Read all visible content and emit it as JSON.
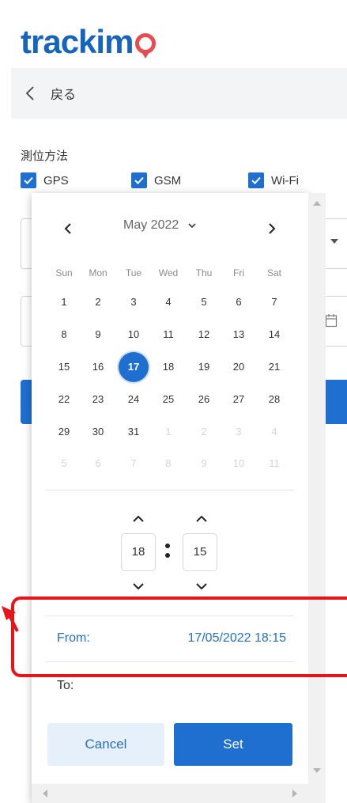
{
  "header": {
    "logo_text": "trackim",
    "brand_color": "#1565c0",
    "pin_color": "#e94b50"
  },
  "nav": {
    "back_label": "戻る"
  },
  "positioning": {
    "section_label": "測位方法",
    "options": [
      {
        "label": "GPS",
        "checked": true
      },
      {
        "label": "GSM",
        "checked": true
      },
      {
        "label": "Wi-Fi",
        "checked": true
      }
    ]
  },
  "picker": {
    "month_label": "May 2022",
    "weekdays": [
      "Sun",
      "Mon",
      "Tue",
      "Wed",
      "Thu",
      "Fri",
      "Sat"
    ],
    "weeks": [
      [
        "1",
        "2",
        "3",
        "4",
        "5",
        "6",
        "7"
      ],
      [
        "8",
        "9",
        "10",
        "11",
        "12",
        "13",
        "14"
      ],
      [
        "15",
        "16",
        "17",
        "18",
        "19",
        "20",
        "21"
      ],
      [
        "22",
        "23",
        "24",
        "25",
        "26",
        "27",
        "28"
      ],
      [
        "29",
        "30",
        "31",
        "1",
        "2",
        "3",
        "4"
      ],
      [
        "5",
        "6",
        "7",
        "8",
        "9",
        "10",
        "11"
      ]
    ],
    "selected_day": "17",
    "time": {
      "hour": "18",
      "minute": "15"
    },
    "from_label": "From:",
    "from_value": "17/05/2022 18:15",
    "to_label": "To:",
    "cancel_label": "Cancel",
    "set_label": "Set",
    "accent_color": "#1e6fd0"
  },
  "annotation": {
    "color": "#e8141a"
  }
}
